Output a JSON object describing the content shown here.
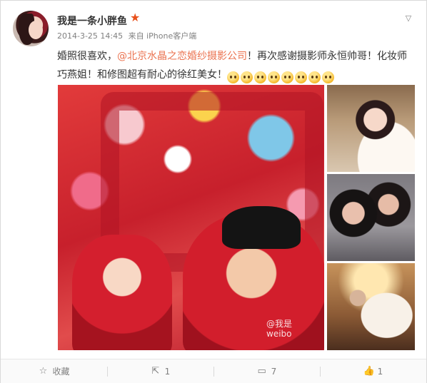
{
  "post": {
    "username": "我是一条小胖鱼",
    "badge_icon": "star-icon",
    "timestamp": "2014-3-25 14:45",
    "source": "来自 iPhone客户端",
    "text_before_mention": "婚照很喜欢，",
    "mention": "@北京水晶之恋婚纱摄影公司",
    "text_after_mention": "！再次感谢摄影师永恒帅哥！化妆师巧燕姐！和修图超有耐心的徐红美女！",
    "emoji_count": 8,
    "watermark": "@我是\nweibo"
  },
  "actions": {
    "favorite_label": "收藏",
    "repost_count": "1",
    "comment_count": "7",
    "like_count": "1"
  },
  "colors": {
    "mention": "#eb7350",
    "star": "#e8501b",
    "meta": "#808080"
  }
}
